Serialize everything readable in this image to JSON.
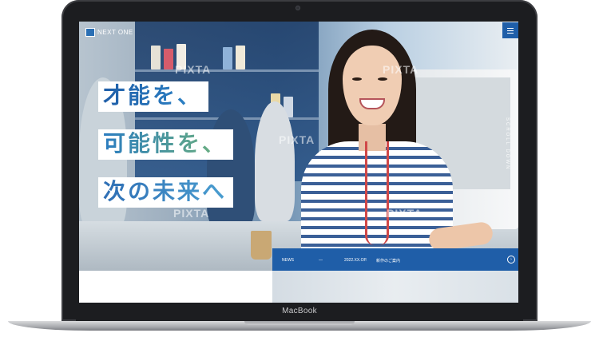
{
  "device": {
    "brand_label": "MacBook"
  },
  "site": {
    "logo_text": "NEXT ONE",
    "menu_icon": "hamburger-icon",
    "headline": [
      "才能を、",
      "可能性を、",
      "次の未来へ"
    ],
    "vertical_text": "SCROLL DOWN",
    "watermark": "PIXTA",
    "news": {
      "label": "NEWS",
      "separator": "—",
      "date": "2022.XX.OP.",
      "title": "新作のご案内",
      "arrow_icon": "arrow-right-circle-icon"
    },
    "colors": {
      "brand_blue": "#1f5ea8",
      "accent_green": "#6fb37a"
    }
  }
}
